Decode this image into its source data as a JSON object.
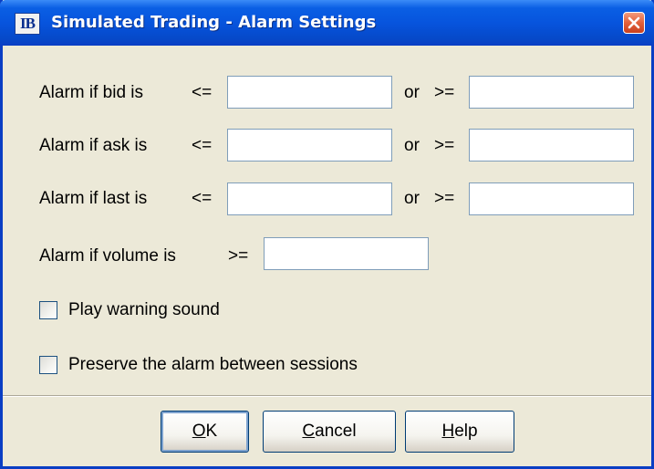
{
  "window": {
    "app_icon_text": "IB",
    "title": "Simulated Trading - Alarm Settings"
  },
  "alarms": {
    "bid": {
      "label": "Alarm if bid is",
      "le_op": "<=",
      "or_label": "or",
      "ge_op": ">=",
      "le_value": "",
      "ge_value": ""
    },
    "ask": {
      "label": "Alarm if ask is",
      "le_op": "<=",
      "or_label": "or",
      "ge_op": ">=",
      "le_value": "",
      "ge_value": ""
    },
    "last": {
      "label": "Alarm if last is",
      "le_op": "<=",
      "or_label": "or",
      "ge_op": ">=",
      "le_value": "",
      "ge_value": ""
    },
    "volume": {
      "label": "Alarm if volume is",
      "ge_op": ">=",
      "ge_value": ""
    }
  },
  "options": {
    "play_sound": {
      "label": "Play warning sound",
      "checked": false
    },
    "preserve": {
      "label": "Preserve the alarm between sessions",
      "checked": false
    }
  },
  "buttons": {
    "ok": {
      "mnemonic": "O",
      "rest": "K"
    },
    "cancel": {
      "mnemonic": "C",
      "rest": "ancel"
    },
    "help": {
      "mnemonic": "H",
      "rest": "elp"
    }
  },
  "icons": {
    "app": "ib-logo-icon",
    "close": "close-icon"
  },
  "colors": {
    "title_bar": "#0754dd",
    "window_border": "#0a3ec4",
    "dialog_background": "#ece9d8",
    "close_button": "#e2603a",
    "field_border": "#7f9db9"
  }
}
